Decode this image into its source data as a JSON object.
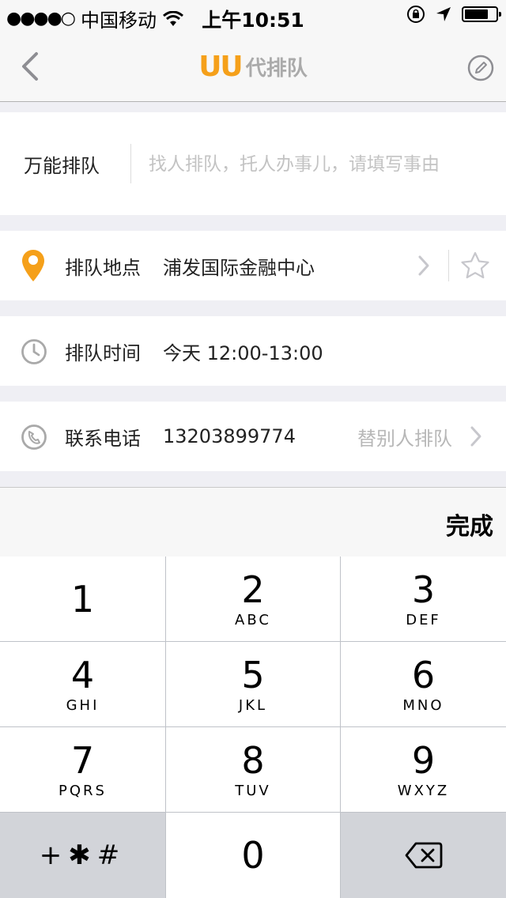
{
  "status_bar": {
    "signal": "●●●●○",
    "carrier": "中国移动",
    "time": "上午10:51",
    "battery_level": 0.75
  },
  "nav": {
    "logo_mark": "UU",
    "title": "代排队"
  },
  "task": {
    "label": "万能排队",
    "placeholder": "找人排队，托人办事儿，请填写事由",
    "value": ""
  },
  "location": {
    "label": "排队地点",
    "value": "浦发国际金融中心"
  },
  "time_row": {
    "label": "排队时间",
    "value": "今天 12:00-13:00"
  },
  "contact": {
    "label": "联系电话",
    "value": "13203899774",
    "action": "替别人排队"
  },
  "done_label": "完成",
  "keypad": {
    "keys": [
      {
        "num": "1",
        "letters": ""
      },
      {
        "num": "2",
        "letters": "ABC"
      },
      {
        "num": "3",
        "letters": "DEF"
      },
      {
        "num": "4",
        "letters": "GHI"
      },
      {
        "num": "5",
        "letters": "JKL"
      },
      {
        "num": "6",
        "letters": "MNO"
      },
      {
        "num": "7",
        "letters": "PQRS"
      },
      {
        "num": "8",
        "letters": "TUV"
      },
      {
        "num": "9",
        "letters": "WXYZ"
      },
      {
        "num": "0",
        "letters": ""
      }
    ],
    "symbols": "+✱#"
  },
  "colors": {
    "accent": "#f5a01a",
    "muted_text": "#b7b7b7",
    "background": "#efeff4"
  }
}
